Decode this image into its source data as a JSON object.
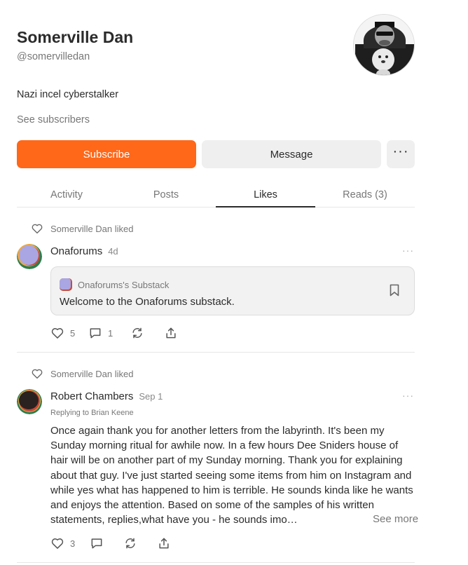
{
  "profile": {
    "name": "Somerville Dan",
    "handle": "@somervilledan",
    "bio": "Nazi incel cyberstalker",
    "see_subscribers": "See subscribers"
  },
  "buttons": {
    "subscribe": "Subscribe",
    "message": "Message",
    "more": "···"
  },
  "tabs": [
    {
      "label": "Activity",
      "active": false
    },
    {
      "label": "Posts",
      "active": false
    },
    {
      "label": "Likes",
      "active": true
    },
    {
      "label": "Reads (3)",
      "active": false
    }
  ],
  "feed": [
    {
      "liked_label": "Somerville Dan liked",
      "author": "Onaforums",
      "date": "4d",
      "more": "···",
      "quote": {
        "publication": "Onaforums's Substack",
        "title": "Welcome to the Onaforums substack."
      },
      "likes": "5",
      "comments": "1"
    },
    {
      "liked_label": "Somerville Dan liked",
      "author": "Robert Chambers",
      "date": "Sep 1",
      "more": "···",
      "replying_to": "Replying to Brian Keene",
      "body": "Once again thank you for another letters from the labyrinth. It's been my Sunday morning ritual for awhile now. In a few hours Dee Sniders house of hair will be on another part of my Sunday morning. Thank you for explaining about that guy. I've just started seeing some items from him on Instagram and while yes what has happened to him is terrible. He sounds kinda like he wants and enjoys the attention. Based on some of the samples of his written statements, replies,what have you - he sounds imo…",
      "see_more": "See more",
      "likes": "3"
    }
  ],
  "colors": {
    "accent": "#ff6719",
    "button_secondary": "#efefef",
    "text_primary": "#2b2b2b",
    "text_muted": "#777777"
  },
  "icons": [
    "heart-icon",
    "comment-icon",
    "restack-icon",
    "share-icon",
    "bookmark-icon",
    "ellipsis-icon"
  ]
}
